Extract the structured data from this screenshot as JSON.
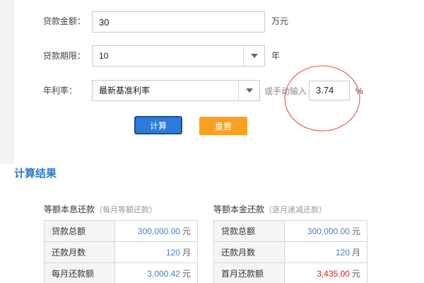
{
  "form": {
    "loan_amount": {
      "label": "贷款金额：",
      "value": "30",
      "unit": "万元"
    },
    "loan_term": {
      "label": "贷款期限：",
      "value": "10",
      "unit": "年",
      "arrow_icon": "chevron-down-icon"
    },
    "interest_rate": {
      "label": "年利率：",
      "selected": "最新基准利率",
      "manual_hint": "或手动输入",
      "manual_value": "3.74",
      "unit": "%"
    },
    "buttons": {
      "calculate": "计算",
      "reset": "重置"
    }
  },
  "results": {
    "title": "计算结果",
    "equal_installment": {
      "caption": "等额本息还款",
      "caption_sub": "（每月等额还款）",
      "rows": [
        {
          "label": "贷款总额",
          "value": "300,000.00",
          "unit": "元"
        },
        {
          "label": "还款月数",
          "value": "120",
          "unit": "月"
        },
        {
          "label": "每月还款额",
          "value": "3,000.42",
          "unit": "元"
        }
      ]
    },
    "equal_principal": {
      "caption": "等额本金还款",
      "caption_sub": "（逐月递减还款）",
      "rows": [
        {
          "label": "贷款总额",
          "value": "300,000.00",
          "unit": "元"
        },
        {
          "label": "还款月数",
          "value": "120",
          "unit": "月"
        },
        {
          "label": "首月还款额",
          "value": "3,435.00",
          "unit": "元"
        }
      ]
    }
  },
  "colors": {
    "accent_blue": "#2e7ad8",
    "reset_orange": "#f9a022",
    "highlight_red": "#e02020",
    "annotation_circle": "#e86a6a"
  }
}
